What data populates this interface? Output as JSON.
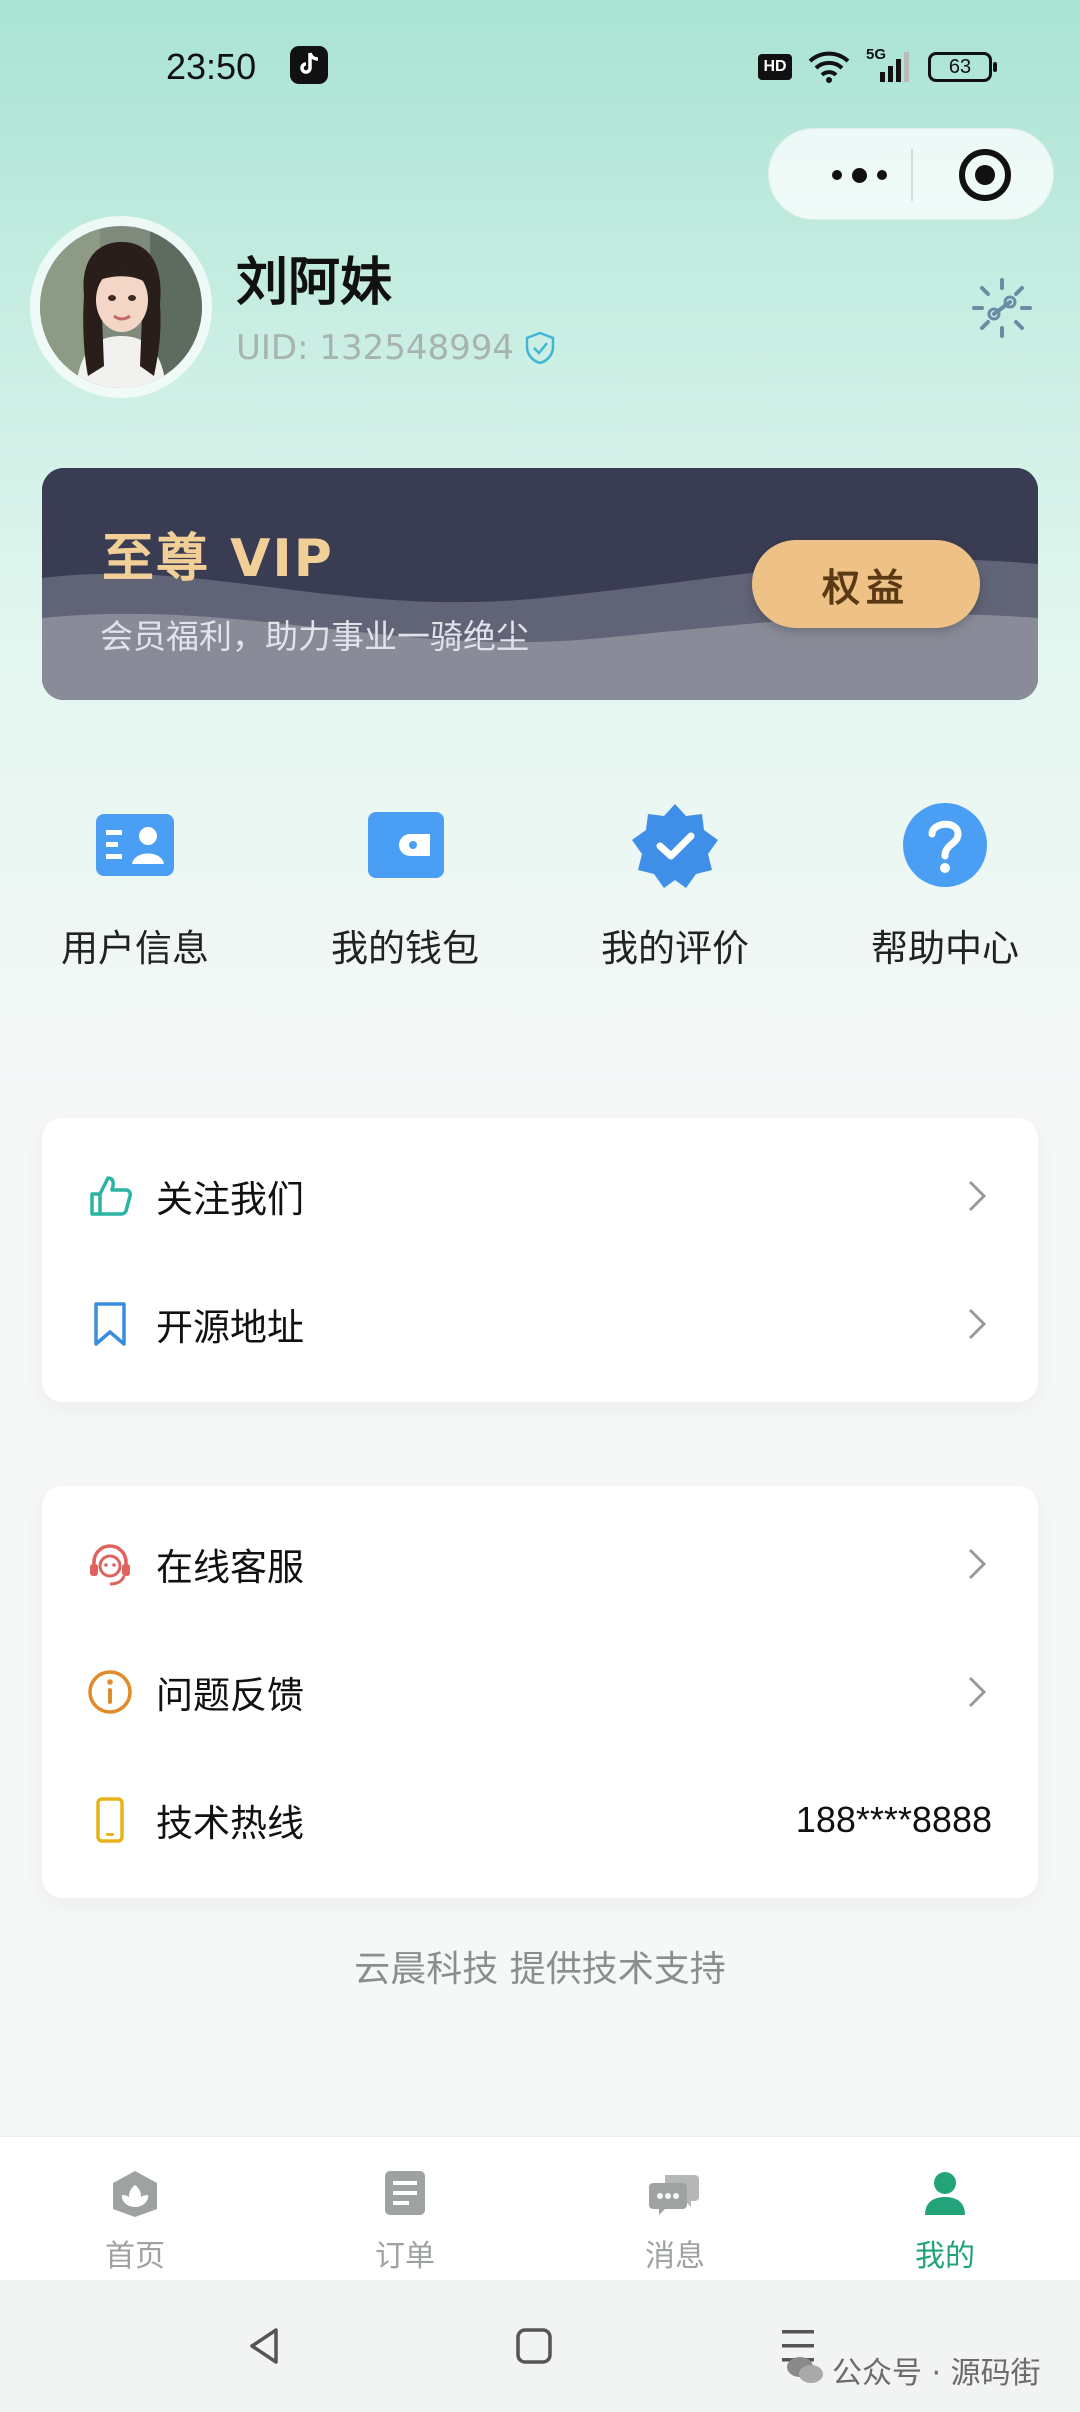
{
  "status_bar": {
    "time": "23:50",
    "hd": "HD",
    "network": "5G",
    "battery": "63"
  },
  "profile": {
    "name": "刘阿妹",
    "uid": "UID: 132548994"
  },
  "vip": {
    "title": "至尊 VIP",
    "subtitle": "会员福利，助力事业一骑绝尘",
    "button": "权益"
  },
  "quick_actions": [
    {
      "label": "用户信息",
      "icon": "user-info-card-icon"
    },
    {
      "label": "我的钱包",
      "icon": "wallet-icon"
    },
    {
      "label": "我的评价",
      "icon": "badge-check-icon"
    },
    {
      "label": "帮助中心",
      "icon": "help-icon"
    }
  ],
  "menu_group_1": [
    {
      "label": "关注我们",
      "icon": "thumbs-up-icon",
      "color": "#2bb3a3"
    },
    {
      "label": "开源地址",
      "icon": "bookmark-icon",
      "color": "#3a8dde"
    }
  ],
  "menu_group_2": [
    {
      "label": "在线客服",
      "icon": "headset-icon",
      "color": "#e0625f"
    },
    {
      "label": "问题反馈",
      "icon": "info-circle-icon",
      "color": "#e08a2a"
    },
    {
      "label": "技术热线",
      "icon": "phone-icon",
      "color": "#e8b21a",
      "value": "188****8888"
    }
  ],
  "footer_note": "云晨科技 提供技术支持",
  "tabs": [
    {
      "label": "首页",
      "icon": "home-leaf-icon"
    },
    {
      "label": "订单",
      "icon": "order-list-icon"
    },
    {
      "label": "消息",
      "icon": "message-icon"
    },
    {
      "label": "我的",
      "icon": "profile-icon",
      "active": true
    }
  ],
  "watermark": "公众号 · 源码街",
  "colors": {
    "accent": "#22a37a",
    "vip_gold": "#f3cf98",
    "vip_bg": "#3b3d55",
    "quick_icon": "#4a9ff5"
  }
}
